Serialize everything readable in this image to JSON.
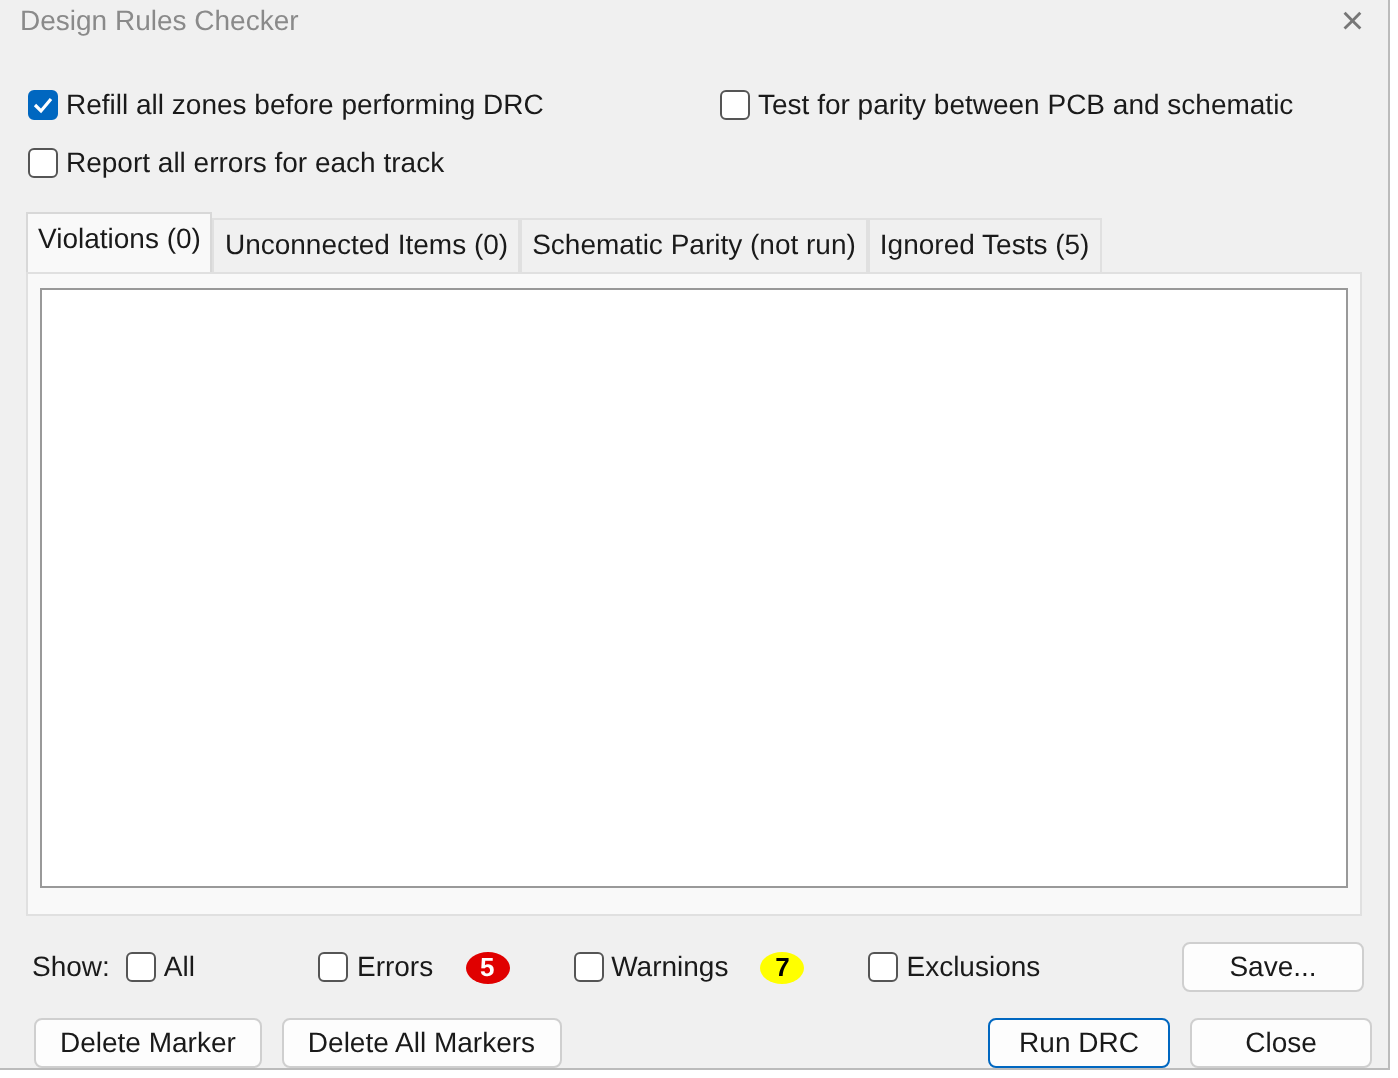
{
  "window": {
    "title": "Design Rules Checker",
    "close": "×"
  },
  "options": [
    {
      "label": "Refill all zones before performing DRC",
      "checked": true
    },
    {
      "label": "Test for parity between PCB and schematic",
      "checked": false
    },
    {
      "label": "Report all errors for each track",
      "checked": false
    }
  ],
  "tabs": [
    {
      "label": "Violations (0)",
      "selected": true
    },
    {
      "label": "Unconnected Items (0)",
      "selected": false
    },
    {
      "label": "Schematic Parity (not run)",
      "selected": false
    },
    {
      "label": "Ignored Tests (5)",
      "selected": false
    }
  ],
  "show": {
    "label": "Show:",
    "filters": [
      {
        "label": "All",
        "checked": false
      },
      {
        "label": "Errors",
        "checked": false,
        "count": "5",
        "color": "#e00000"
      },
      {
        "label": "Warnings",
        "checked": false,
        "count": "7",
        "color": "#ffff00"
      },
      {
        "label": "Exclusions",
        "checked": false
      }
    ]
  },
  "save_button": "Save...",
  "buttons": [
    {
      "label": "Delete Marker",
      "default": false
    },
    {
      "label": "Delete All Markers",
      "default": false
    },
    {
      "label": "Run DRC",
      "default": true
    },
    {
      "label": "Close",
      "default": false
    }
  ]
}
